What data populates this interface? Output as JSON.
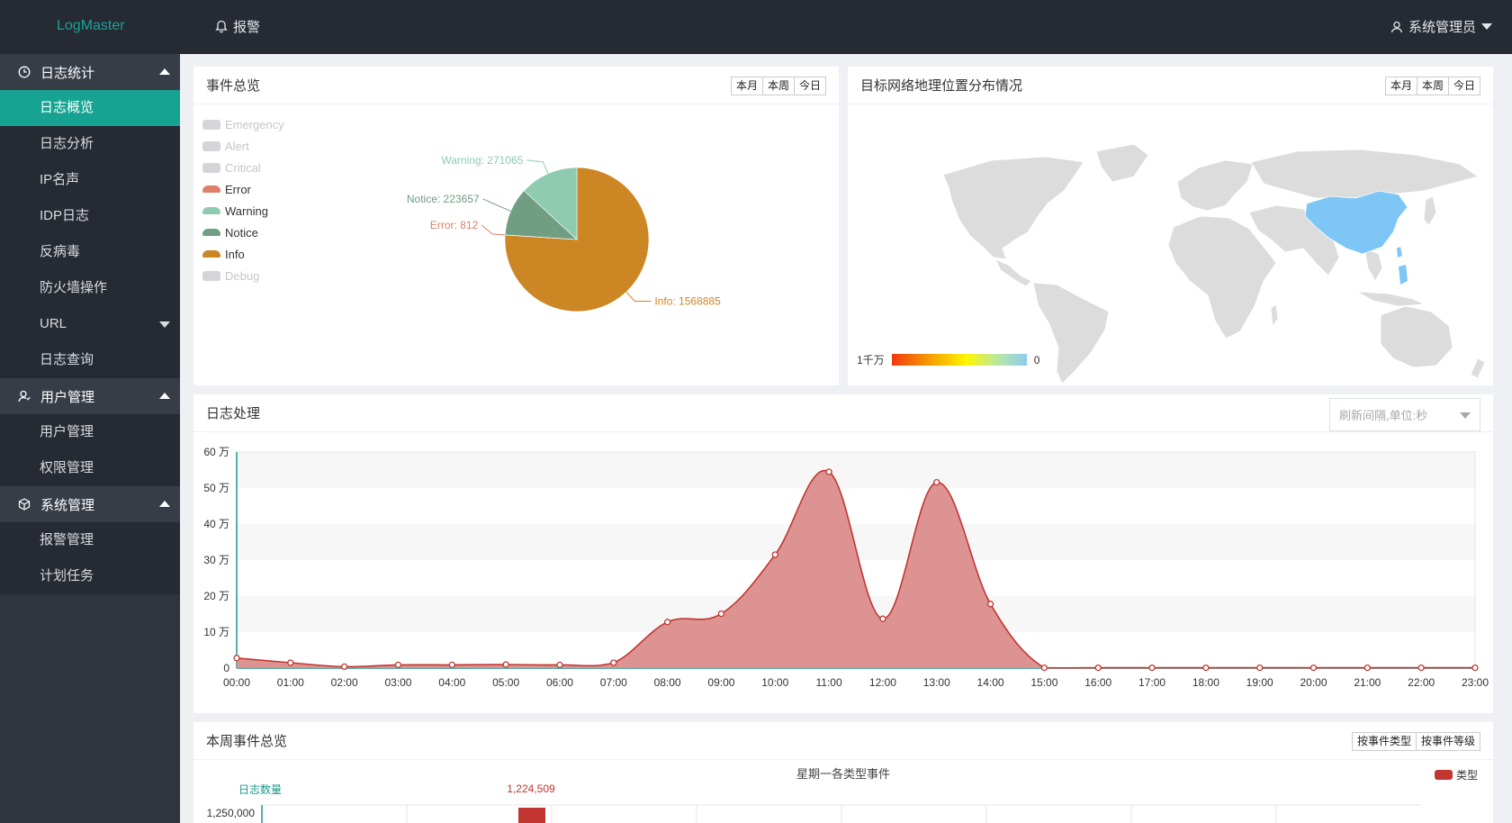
{
  "app": {
    "brand": "LogMaster"
  },
  "topbar": {
    "alert_label": "报警",
    "user_label": "系统管理员"
  },
  "sidebar": {
    "groups": [
      {
        "label": "日志统计",
        "items": [
          "日志概览",
          "日志分析",
          "IP名声",
          "IDP日志",
          "反病毒",
          "防火墙操作",
          "URL",
          "日志查询"
        ]
      },
      {
        "label": "用户管理",
        "items": [
          "用户管理",
          "权限管理"
        ]
      },
      {
        "label": "系统管理",
        "items": [
          "报警管理",
          "计划任务"
        ]
      }
    ],
    "active_item": "日志概览"
  },
  "panels": {
    "events": {
      "title": "事件总览",
      "buttons": [
        "本月",
        "本周",
        "今日"
      ],
      "legend": [
        {
          "name": "Emergency",
          "color": "#d3d5d8",
          "enabled": false
        },
        {
          "name": "Alert",
          "color": "#d3d5d8",
          "enabled": false
        },
        {
          "name": "Critical",
          "color": "#d3d5d8",
          "enabled": false
        },
        {
          "name": "Error",
          "color": "#de7f6a",
          "enabled": true
        },
        {
          "name": "Warning",
          "color": "#8ecbb0",
          "enabled": true
        },
        {
          "name": "Notice",
          "color": "#6f9e83",
          "enabled": true
        },
        {
          "name": "Info",
          "color": "#cc8624",
          "enabled": true
        },
        {
          "name": "Debug",
          "color": "#d3d5d8",
          "enabled": false
        }
      ],
      "slice_labels": {
        "error": "Error: 812",
        "notice": "Notice: 223657",
        "warning": "Warning: 271065",
        "info": "Info: 1568885"
      }
    },
    "geo": {
      "title": "目标网络地理位置分布情况",
      "buttons": [
        "本月",
        "本周",
        "今日"
      ],
      "scale_max": "1千万",
      "scale_min": "0"
    },
    "processing": {
      "title": "日志处理",
      "select_placeholder": "刷新间隔,单位:秒"
    },
    "weekly": {
      "title": "本周事件总览",
      "buttons": [
        "按事件类型",
        "按事件等级"
      ],
      "chart_title": "星期一各类型事件",
      "axis_name": "日志数量",
      "legend_label": "类型",
      "first_tick": "1,250,000",
      "bar_label": "1,224,509"
    }
  },
  "chart_data": [
    {
      "type": "pie",
      "title": "事件总览",
      "slices": [
        {
          "name": "Error",
          "value": 812,
          "color": "#de7f6a"
        },
        {
          "name": "Notice",
          "value": 223657,
          "color": "#6f9e83"
        },
        {
          "name": "Warning",
          "value": 271065,
          "color": "#8ecbb0"
        },
        {
          "name": "Info",
          "value": 1568885,
          "color": "#cc8624"
        }
      ]
    },
    {
      "type": "area",
      "title": "日志处理",
      "color": "#c23531",
      "fill": "#dc8d8d",
      "x": [
        "00:00",
        "01:00",
        "02:00",
        "03:00",
        "04:00",
        "05:00",
        "06:00",
        "07:00",
        "08:00",
        "09:00",
        "10:00",
        "11:00",
        "12:00",
        "13:00",
        "14:00",
        "15:00",
        "16:00",
        "17:00",
        "18:00",
        "19:00",
        "20:00",
        "21:00",
        "22:00",
        "23:00"
      ],
      "values": [
        28000,
        15000,
        4000,
        9000,
        9000,
        10000,
        9000,
        15000,
        128000,
        151000,
        315000,
        545000,
        137000,
        516000,
        178000,
        1000,
        1000,
        1000,
        1000,
        1000,
        1000,
        1000,
        1000,
        1000
      ],
      "y_ticks": [
        "0",
        "10 万",
        "20 万",
        "30 万",
        "40 万",
        "50 万",
        "60 万"
      ],
      "ylim": [
        0,
        600000
      ]
    },
    {
      "type": "bar",
      "title": "星期一各类型事件",
      "ylabel": "日志数量",
      "legend": [
        "类型"
      ],
      "values": [
        1224509
      ]
    }
  ]
}
